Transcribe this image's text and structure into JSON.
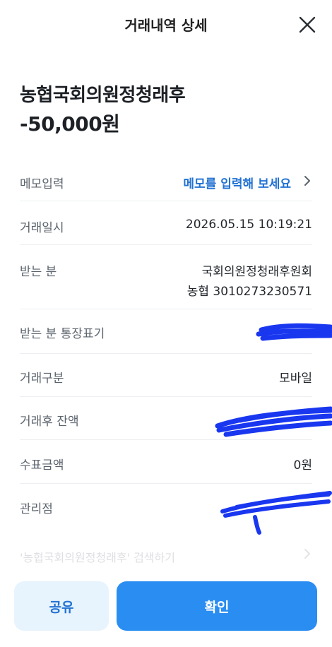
{
  "header": {
    "title": "거래내역 상세",
    "close_icon": "close-icon"
  },
  "summary": {
    "payee": "농협국회의원정청래후",
    "amount": "-50,000원"
  },
  "details": {
    "memo": {
      "label": "메모입력",
      "value": "메모를 입력해 보세요"
    },
    "datetime": {
      "label": "거래일시",
      "value": "2026.05.15 10:19:21"
    },
    "recipient": {
      "label": "받는 분",
      "name": "국회의원정청래후원회",
      "account": "농협 3010273230571"
    },
    "passbook": {
      "label": "받는 분 통장표기"
    },
    "type": {
      "label": "거래구분",
      "value": "모바일"
    },
    "balance": {
      "label": "거래후 잔액"
    },
    "fee": {
      "label": "수표금액",
      "value": "0원"
    },
    "branch": {
      "label": "관리점"
    }
  },
  "search_link": {
    "label": "'농협국회의원정청래후' 검색하기"
  },
  "buttons": {
    "share": "공유",
    "confirm": "확인"
  },
  "colors": {
    "accent": "#2a8df1",
    "link": "#2272d3",
    "scribble": "#1a37f0"
  }
}
